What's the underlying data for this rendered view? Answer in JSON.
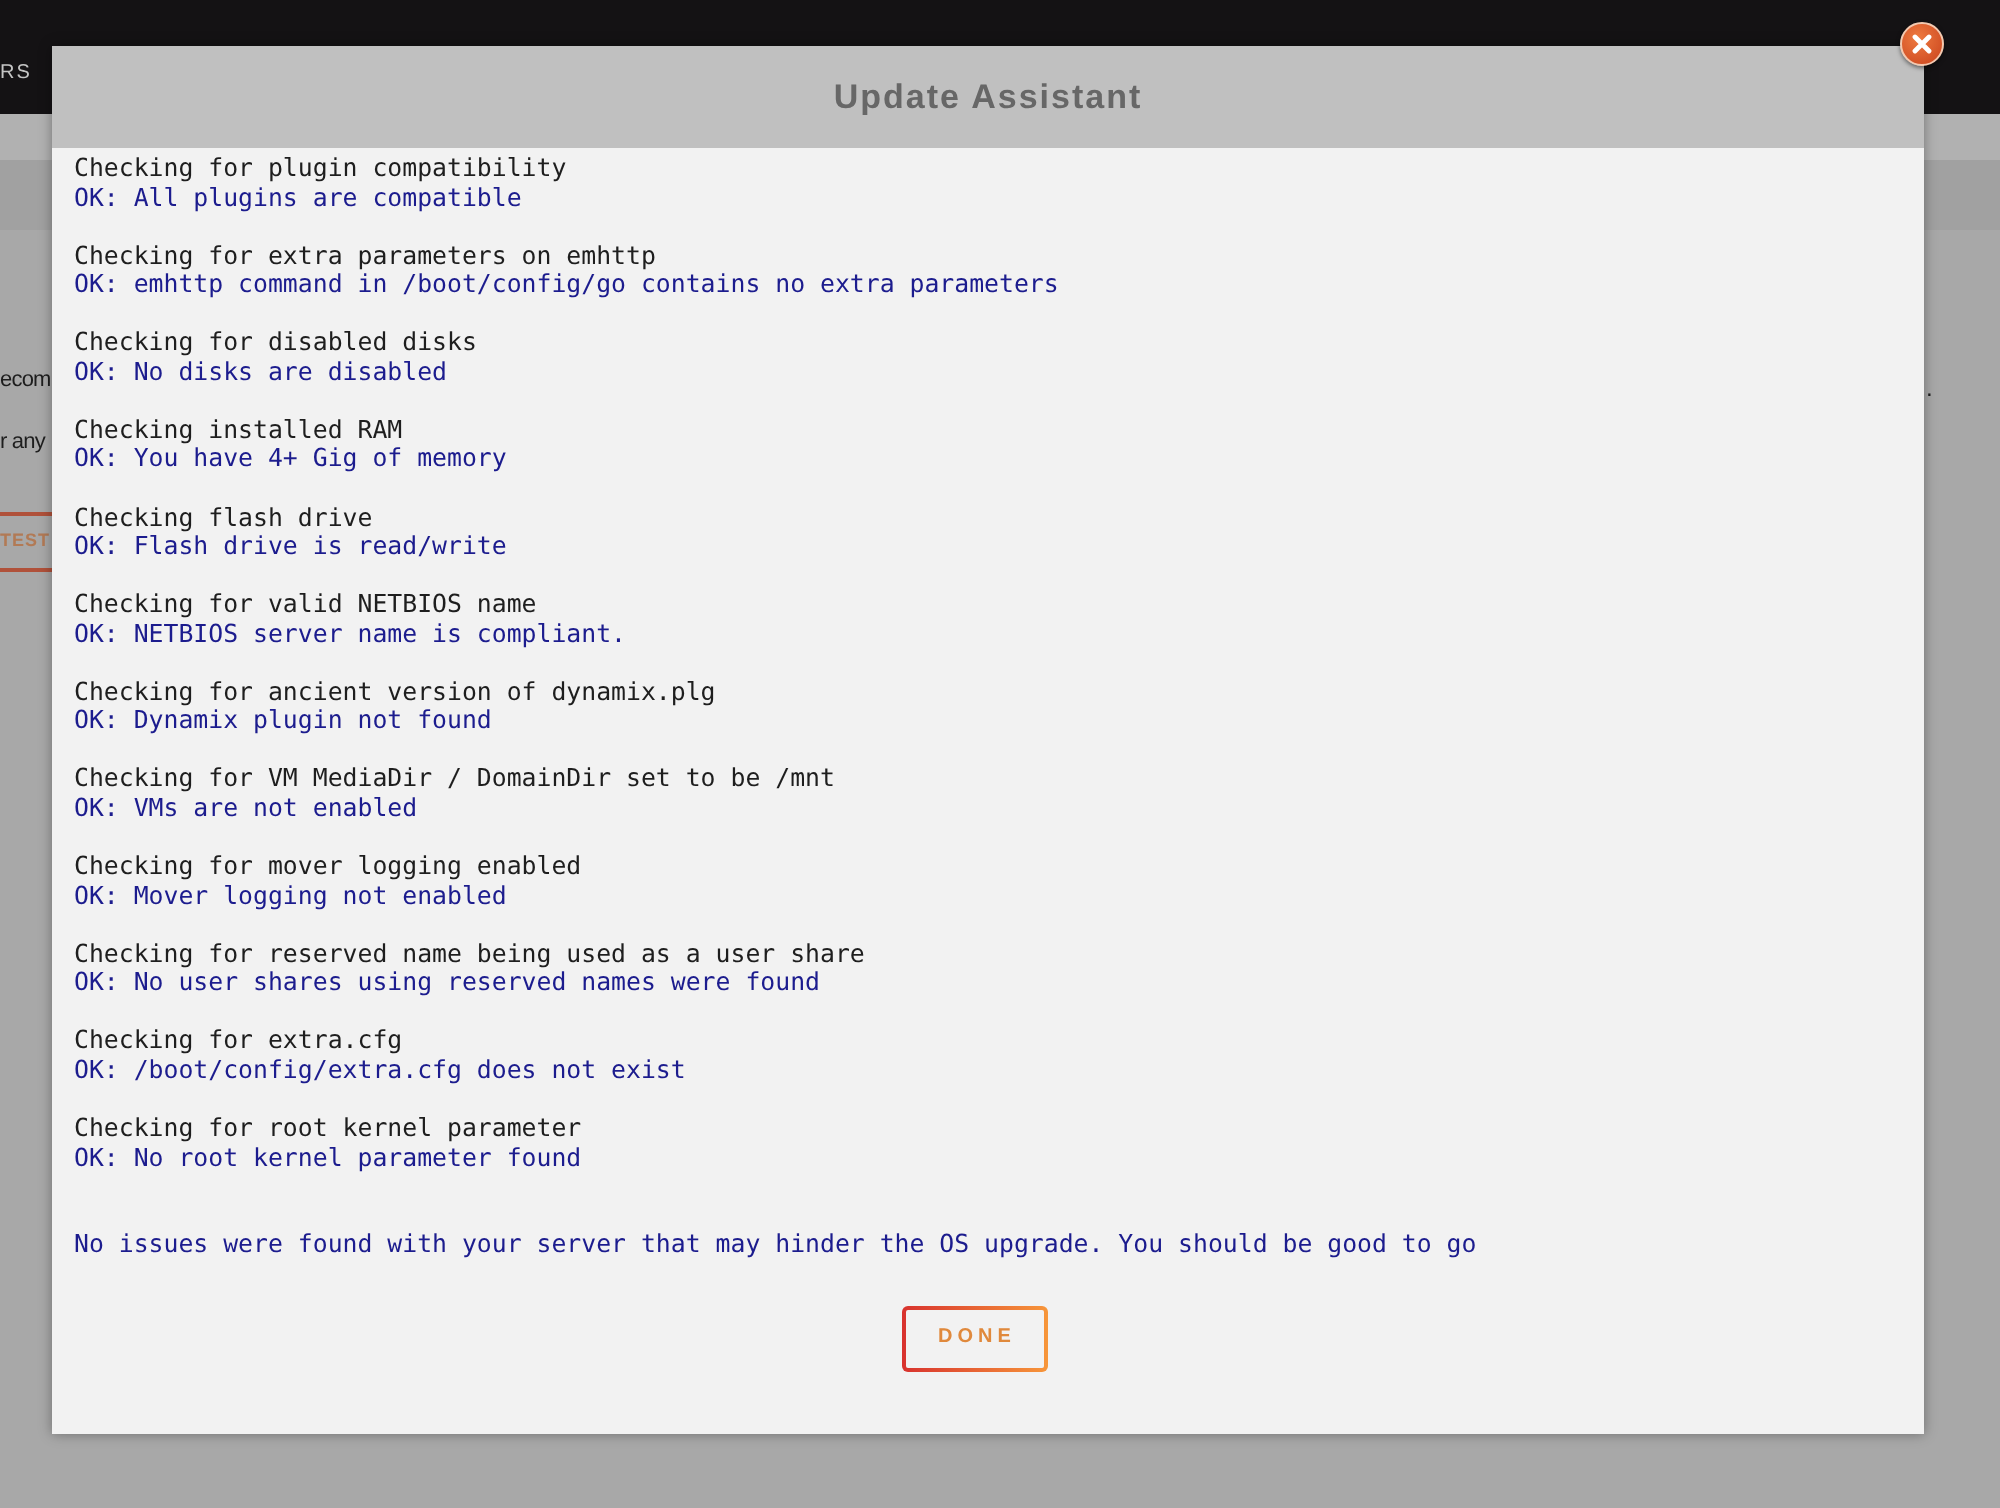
{
  "background_page": {
    "nav_item": "RS",
    "text_lines": [
      "ecom",
      "r any"
    ],
    "button": "TEST",
    "text_right": "."
  },
  "window": {
    "title": "Update Assistant"
  },
  "checks": [
    {
      "label": "Checking for plugin compatibility",
      "result": "OK: All plugins are compatible"
    },
    {
      "label": "Checking for extra parameters on emhttp",
      "result": "OK: emhttp command in /boot/config/go contains no extra parameters"
    },
    {
      "label": "Checking for disabled disks",
      "result": "OK: No disks are disabled"
    },
    {
      "label": "Checking installed RAM",
      "result": "OK: You have 4+ Gig of memory"
    },
    {
      "label": "Checking flash drive",
      "result": "OK: Flash drive is read/write"
    },
    {
      "label": "Checking for valid NETBIOS name",
      "result": "OK: NETBIOS server name is compliant."
    },
    {
      "label": "Checking for ancient version of dynamix.plg",
      "result": "OK: Dynamix plugin not found"
    },
    {
      "label": "Checking for VM MediaDir / DomainDir set to be /mnt",
      "result": "OK: VMs are not enabled"
    },
    {
      "label": "Checking for mover logging enabled",
      "result": "OK: Mover logging not enabled"
    },
    {
      "label": "Checking for reserved name being used as a user share",
      "result": "OK: No user shares using reserved names were found"
    },
    {
      "label": "Checking for extra.cfg",
      "result": "OK: /boot/config/extra.cfg does not exist"
    },
    {
      "label": "Checking for root kernel parameter",
      "result": "OK: No root kernel parameter found"
    }
  ],
  "summary": "No issues were found with your server that may hinder the OS upgrade. You should be good to go",
  "buttons": [
    {
      "label": "DONE"
    }
  ]
}
